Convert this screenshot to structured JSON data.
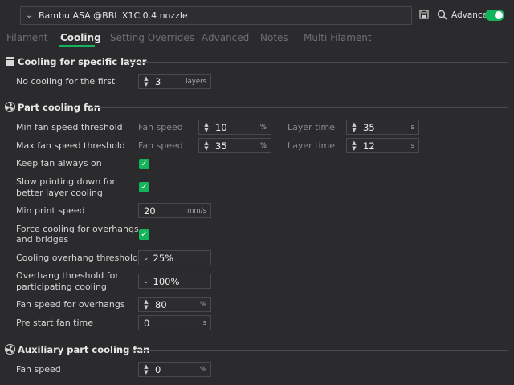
{
  "header": {
    "preset": "Bambu ASA @BBL X1C 0.4 nozzle",
    "advanced_label": "Advanced",
    "advanced_on": true
  },
  "tabs": [
    {
      "label": "Filament",
      "active": false
    },
    {
      "label": "Cooling",
      "active": true
    },
    {
      "label": "Setting Overrides",
      "active": false
    },
    {
      "label": "Advanced",
      "active": false
    },
    {
      "label": "Notes",
      "active": false
    },
    {
      "label": "Multi Filament",
      "active": false
    }
  ],
  "sections": {
    "specific_layer": {
      "title": "Cooling for specific layer",
      "no_cooling": {
        "label": "No cooling for the first",
        "value": "3",
        "unit": "layers"
      }
    },
    "part_fan": {
      "title": "Part cooling fan",
      "min_threshold": {
        "label": "Min fan speed threshold",
        "fan_label": "Fan speed",
        "fan_value": "10",
        "fan_unit": "%",
        "layer_label": "Layer time",
        "layer_value": "35",
        "layer_unit": "s"
      },
      "max_threshold": {
        "label": "Max fan speed threshold",
        "fan_label": "Fan speed",
        "fan_value": "35",
        "fan_unit": "%",
        "layer_label": "Layer time",
        "layer_value": "12",
        "layer_unit": "s"
      },
      "keep_fan": {
        "label": "Keep fan always on",
        "checked": true
      },
      "slow_printing": {
        "label_line1": "Slow printing down for",
        "label_line2": "better layer cooling",
        "checked": true
      },
      "min_print_speed": {
        "label": "Min print speed",
        "value": "20",
        "unit": "mm/s"
      },
      "force_cooling": {
        "label_line1": "Force cooling for overhangs",
        "label_line2": "and bridges",
        "checked": true
      },
      "overhang_threshold": {
        "label": "Cooling overhang threshold",
        "value": "25%"
      },
      "overhang_participating": {
        "label_line1": "Overhang threshold for",
        "label_line2": "participating cooling",
        "value": "100%"
      },
      "fan_overhangs": {
        "label": "Fan speed for overhangs",
        "value": "80",
        "unit": "%"
      },
      "pre_start": {
        "label": "Pre start fan time",
        "value": "0",
        "unit": "s"
      }
    },
    "aux_fan": {
      "title": "Auxiliary part cooling fan",
      "fan_speed": {
        "label": "Fan speed",
        "value": "0",
        "unit": "%"
      }
    }
  },
  "colors": {
    "background": "#2b2b2d",
    "accent": "#14b45c",
    "text": "#dcdcdc",
    "muted": "#6f6f73"
  },
  "icons": {
    "preset_dropdown": "chevron-down-icon",
    "save": "save-icon",
    "search": "search-icon",
    "section_layer": "layer-icon",
    "section_fan": "fan-icon",
    "spin": "spin-arrows-icon"
  }
}
